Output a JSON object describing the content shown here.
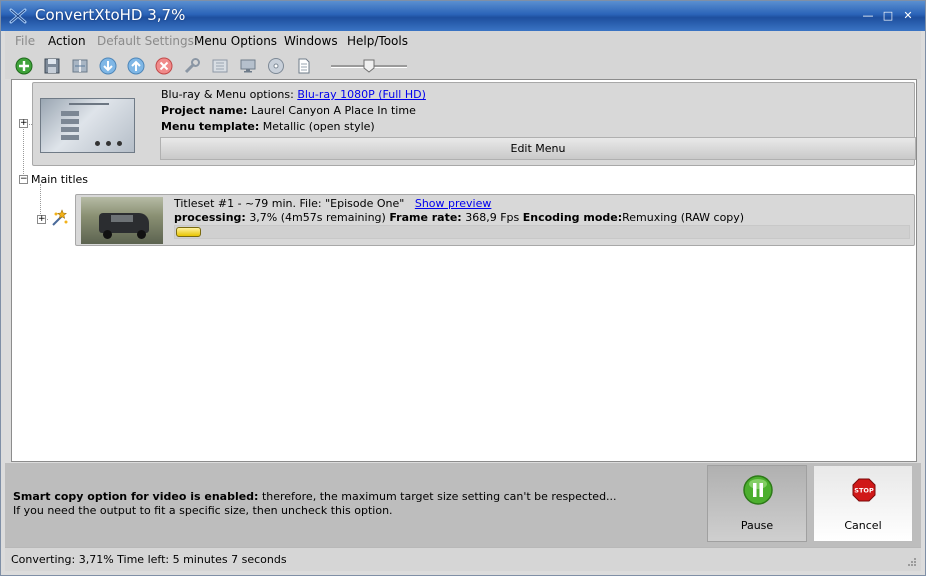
{
  "window": {
    "title": "ConvertXtoHD 3,7%",
    "minimize_glyph": "—",
    "maximize_glyph": "□",
    "close_glyph": "✕"
  },
  "menu": {
    "items": [
      {
        "label": "File",
        "disabled": true
      },
      {
        "label": "Action",
        "disabled": false
      },
      {
        "label": "Default Settings",
        "disabled": true
      },
      {
        "label": "Menu Options",
        "disabled": false
      },
      {
        "label": "Windows",
        "disabled": false
      },
      {
        "label": "Help/Tools",
        "disabled": false
      }
    ]
  },
  "toolbar": {
    "icons": [
      "add-icon",
      "save-icon",
      "split-icon",
      "move-down-icon",
      "move-up-icon",
      "remove-icon",
      "tools-icon",
      "chapters-icon",
      "monitor-icon",
      "disc-icon",
      "document-icon"
    ],
    "zoom_slider_level": 0.5
  },
  "menu_card": {
    "options_label": "Blu-ray & Menu options:",
    "options_value": "Blu-ray 1080P (Full HD)",
    "project_label": "Project name:",
    "project_value": "Laurel Canyon A Place In time",
    "template_label": "Menu template:",
    "template_value": "Metallic (open style)",
    "edit_button": "Edit Menu"
  },
  "tree": {
    "main_titles_label": "Main titles"
  },
  "titleset": {
    "line1": "Titleset #1 - ~79 min. File: \"Episode One\"",
    "preview_link": "Show preview",
    "processing_label": "processing:",
    "processing_value": "3,7% (4m57s remaining)",
    "framerate_label": "Frame rate:",
    "framerate_value": "368,9 Fps",
    "encoding_label": "Encoding mode:",
    "encoding_value": "Remuxing (RAW copy)",
    "progress": 0.037
  },
  "info": {
    "bold_text": "Smart copy option for video is enabled:",
    "text1": "therefore, the maximum target size setting can't be respected...",
    "text2": "If you need the output to fit a specific size, then uncheck this option."
  },
  "buttons": {
    "pause": "Pause",
    "cancel": "Cancel",
    "stop_sign": "STOP"
  },
  "status": {
    "text": "Converting: 3,71% Time left: 5 minutes 7 seconds"
  },
  "colors": {
    "titlebar": "#2a63b8",
    "link": "#0000ee",
    "progress": "#e8c400",
    "pause_green": "#4caf2e",
    "stop_red": "#d01818"
  }
}
